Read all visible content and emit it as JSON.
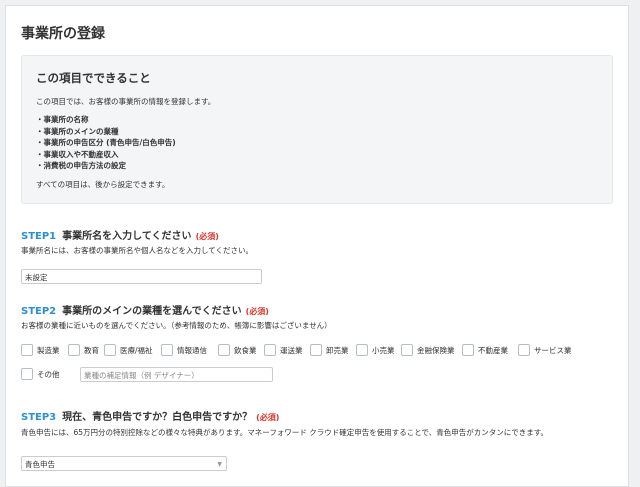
{
  "page": {
    "title": "事業所の登録"
  },
  "info": {
    "title": "この項目でできること",
    "description": "この項目では、お客様の事業所の情報を登録します。",
    "items": [
      "・事業所の名称",
      "・事業所のメインの業種",
      "・事業所の申告区分 (青色申告/白色申告)",
      "・事業収入や不動産収入",
      "・消費税の申告方法の設定"
    ],
    "note": "すべての項目は、後から設定できます。"
  },
  "step1": {
    "num": "STEP1",
    "title": "事業所名を入力してください",
    "required": "(必須)",
    "description": "事業所名には、お客様の事業所名や個人名などを入力してください。",
    "input_value": "未設定"
  },
  "step2": {
    "num": "STEP2",
    "title": "事業所のメインの業種を選んでください",
    "required": "(必須)",
    "description": "お客様の業種に近いものを選んでください。（参考情報のため、帳簿に影響はございません）",
    "options": [
      "製造業",
      "教育",
      "医療/福祉",
      "情報通信",
      "飲食業",
      "運送業",
      "卸売業",
      "小売業",
      "金融保険業",
      "不動産業",
      "サービス業"
    ],
    "other_label": "その他",
    "other_placeholder": "業種の補足情報（例 デザイナー）"
  },
  "step3": {
    "num": "STEP3",
    "title": "現在、青色申告ですか？白色申告ですか？",
    "required": "(必須)",
    "description": "青色申告には、65万円分の特別控除などの様々な特典があります。マネーフォワード クラウド確定申告を使用することで、青色申告がカンタンにできます。",
    "select_value": "青色申告"
  }
}
